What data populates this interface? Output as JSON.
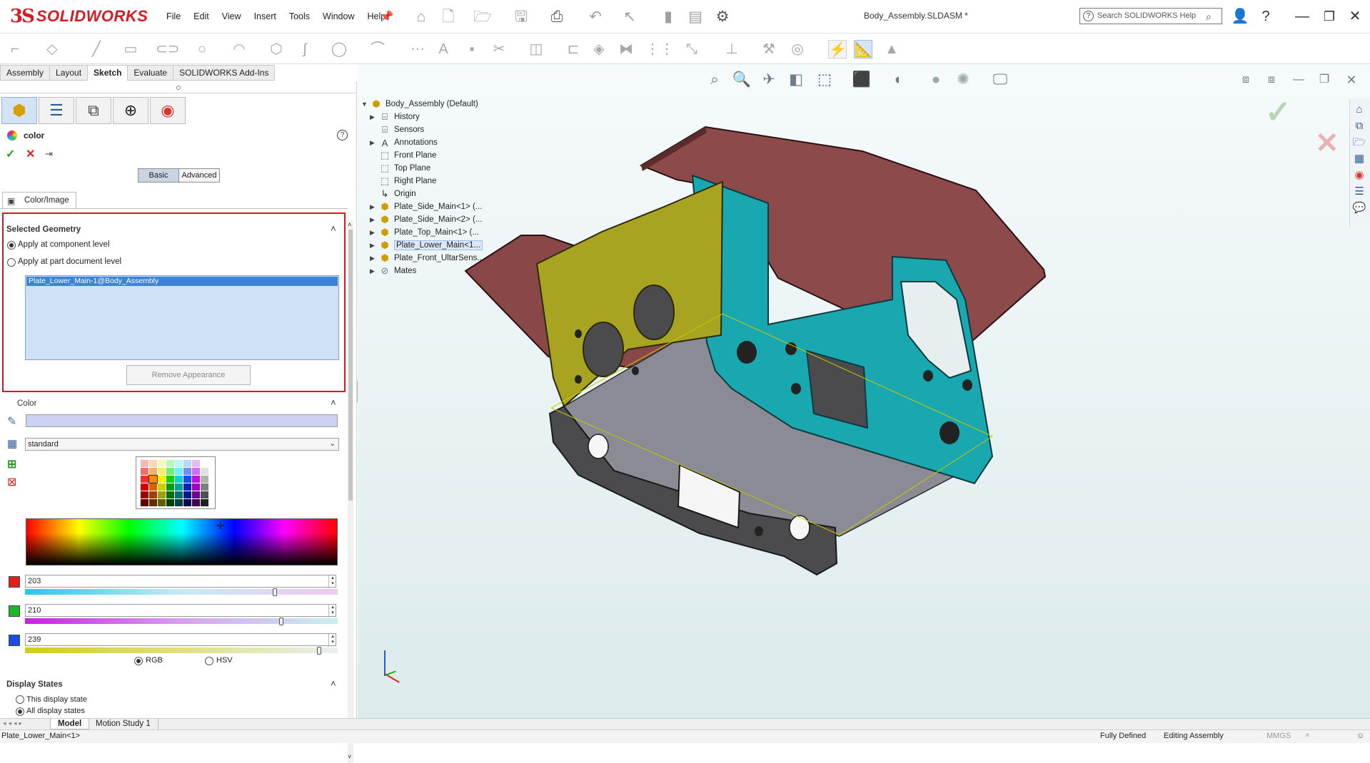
{
  "app": {
    "logo_mark": "3S",
    "logo_text": "SOLIDWORKS",
    "document_title": "Body_Assembly.SLDASM *",
    "search_placeholder": "Search SOLIDWORKS Help"
  },
  "menu": [
    "File",
    "Edit",
    "View",
    "Insert",
    "Tools",
    "Window",
    "Help"
  ],
  "command_tabs": [
    {
      "label": "Assembly",
      "active": false
    },
    {
      "label": "Layout",
      "active": false
    },
    {
      "label": "Sketch",
      "active": true
    },
    {
      "label": "Evaluate",
      "active": false
    },
    {
      "label": "SOLIDWORKS Add-Ins",
      "active": false
    }
  ],
  "property_manager": {
    "title": "color",
    "mode_basic": "Basic",
    "mode_advanced": "Advanced",
    "tab_color_image": "Color/Image",
    "selected_geometry": {
      "heading": "Selected Geometry",
      "option_component": "Apply at component level",
      "option_part_doc": "Apply at part document level",
      "selected_item": "Plate_Lower_Main-1@Body_Assembly",
      "remove_button": "Remove Appearance"
    },
    "color": {
      "heading": "Color",
      "palette_name": "standard",
      "red": "203",
      "green": "210",
      "blue": "239",
      "red_fraction": 0.8,
      "green_fraction": 0.82,
      "blue_fraction": 0.94,
      "mode_rgb": "RGB",
      "mode_hsv": "HSV",
      "current_color": "#cbd2ef"
    },
    "display_states": {
      "heading": "Display States",
      "option_this": "This display state",
      "option_all": "All display states"
    }
  },
  "feature_tree": {
    "root": "Body_Assembly  (Default)",
    "items": [
      {
        "label": "History",
        "icon": "history-icon",
        "expandable": true
      },
      {
        "label": "Sensors",
        "icon": "sensors-icon",
        "expandable": false
      },
      {
        "label": "Annotations",
        "icon": "annotations-icon",
        "expandable": true
      },
      {
        "label": "Front Plane",
        "icon": "plane-icon",
        "expandable": false
      },
      {
        "label": "Top Plane",
        "icon": "plane-icon",
        "expandable": false
      },
      {
        "label": "Right Plane",
        "icon": "plane-icon",
        "expandable": false
      },
      {
        "label": "Origin",
        "icon": "origin-icon",
        "expandable": false
      },
      {
        "label": "Plate_Side_Main<1> (...",
        "icon": "part-icon",
        "expandable": true
      },
      {
        "label": "Plate_Side_Main<2> (...",
        "icon": "part-icon",
        "expandable": true
      },
      {
        "label": "Plate_Top_Main<1> (...",
        "icon": "part-icon",
        "expandable": true
      },
      {
        "label": "Plate_Lower_Main<1...",
        "icon": "part-icon",
        "expandable": true,
        "selected": true
      },
      {
        "label": "Plate_Front_UltarSens...",
        "icon": "part-icon",
        "expandable": true
      },
      {
        "label": "Mates",
        "icon": "mates-icon",
        "expandable": true
      }
    ]
  },
  "bottom_tabs": [
    {
      "label": "Model",
      "active": true
    },
    {
      "label": "Motion Study 1",
      "active": false
    }
  ],
  "status": {
    "left": "Plate_Lower_Main<1>",
    "defined": "Fully Defined",
    "mode": "Editing Assembly",
    "units": "MMGS"
  },
  "colors": {
    "selection_blue": "#3b83d9",
    "red_outline": "#e81123",
    "part_top": "#8c4a4a",
    "part_side": "#1aa8b0",
    "part_yellow": "#a9a322",
    "part_dark": "#4b4b4e",
    "part_floor": "#8b8b95"
  }
}
